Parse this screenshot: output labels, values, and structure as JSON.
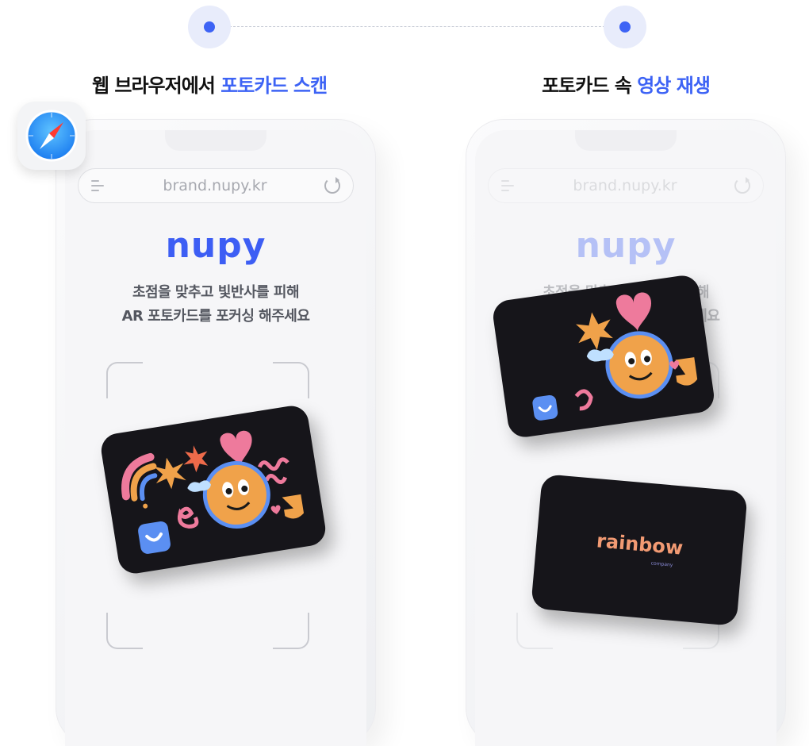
{
  "steps": {
    "left_title_prefix": "웹 브라우저에서 ",
    "left_title_accent": "포토카드 스캔",
    "right_title_prefix": "포토카드 속 ",
    "right_title_accent": "영상 재생"
  },
  "browser": {
    "url": "brand.nupy.kr",
    "logo": "nupy",
    "guide_line1": "초점을 맞추고 빛반사를 피해",
    "guide_line2": "AR 포토카드를 포커싱 해주세요"
  },
  "card_back": {
    "brand": "rainbow",
    "sub": "company"
  },
  "colors": {
    "accent": "#3d63f5",
    "card_bg": "#16151a",
    "sticker_orange": "#f0a24a",
    "sticker_pink": "#ee7a9c",
    "sticker_blue": "#5b8ff2"
  },
  "icons": [
    "safari-icon",
    "menu-icon",
    "reload-icon",
    "step-dot-icon"
  ]
}
